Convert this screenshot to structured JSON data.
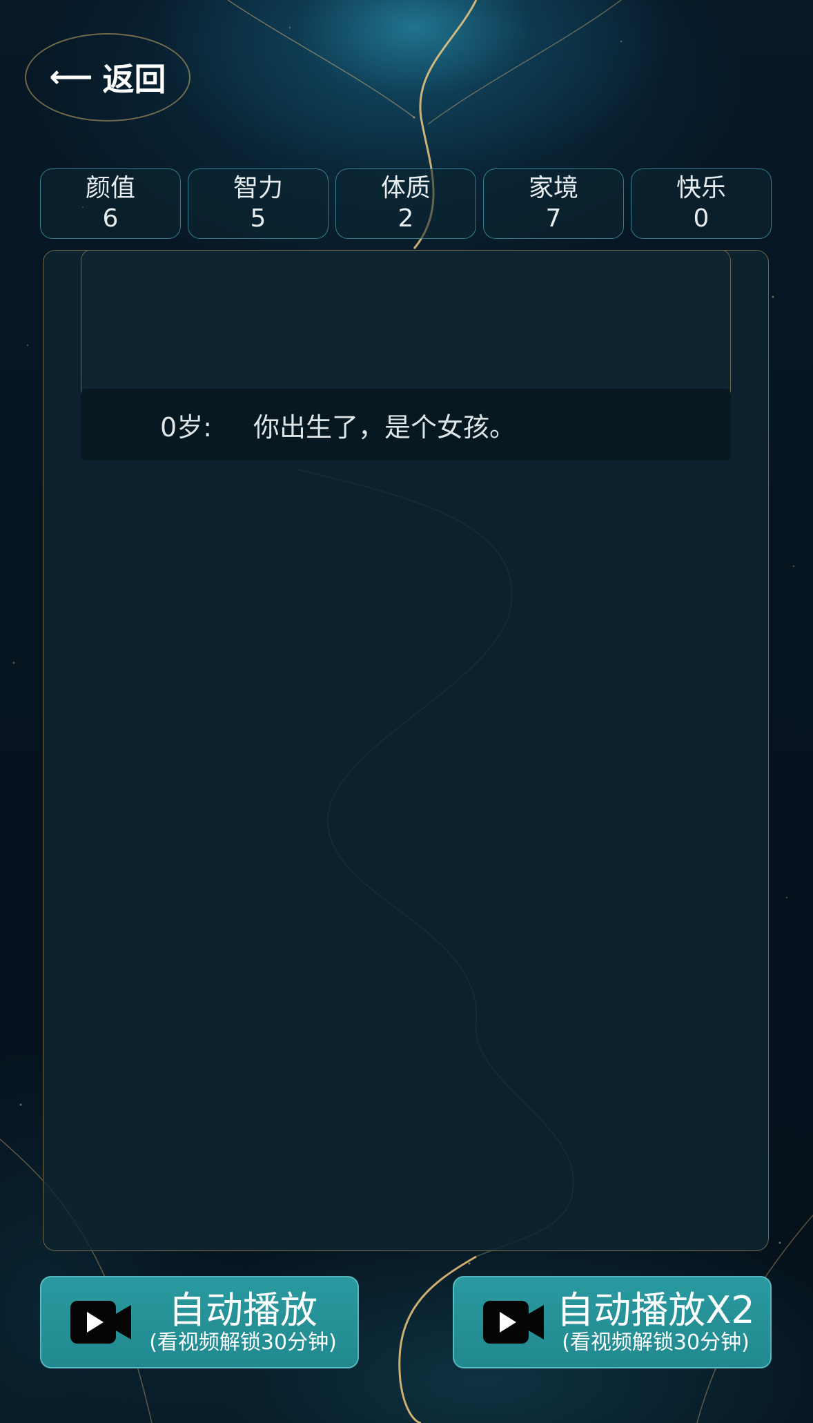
{
  "header": {
    "back_arrow": "⟵",
    "back_label": "返回"
  },
  "stats": [
    {
      "label": "颜值",
      "value": "6"
    },
    {
      "label": "智力",
      "value": "5"
    },
    {
      "label": "体质",
      "value": "2"
    },
    {
      "label": "家境",
      "value": "7"
    },
    {
      "label": "快乐",
      "value": "0"
    }
  ],
  "log": [
    {
      "age": "0岁:",
      "text": "你出生了，是个女孩。"
    }
  ],
  "buttons": {
    "auto_play": {
      "label": "自动播放",
      "sub": "(看视频解锁30分钟)",
      "icon": "video-camera-icon"
    },
    "auto_play_x2": {
      "label": "自动播放X2",
      "sub": "(看视频解锁30分钟)",
      "icon": "video-camera-icon"
    }
  },
  "colors": {
    "button_bg": "#259297",
    "stat_border": "#46aab9",
    "panel_border": "#b4965a"
  }
}
